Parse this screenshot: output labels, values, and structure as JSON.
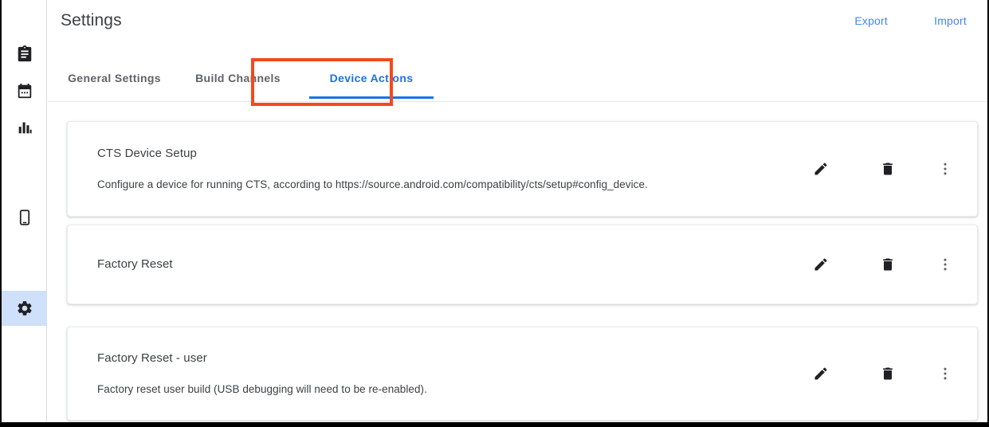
{
  "header": {
    "title": "Settings",
    "export_label": "Export",
    "import_label": "Import"
  },
  "sidebar": {
    "items": [
      {
        "name": "clipboard",
        "icon": "clipboard-icon",
        "active": false
      },
      {
        "name": "calendar",
        "icon": "calendar-icon",
        "active": false
      },
      {
        "name": "analytics",
        "icon": "bar-chart-icon",
        "active": false
      },
      {
        "name": "devices",
        "icon": "phone-icon",
        "active": false
      },
      {
        "name": "settings",
        "icon": "gear-icon",
        "active": true
      }
    ]
  },
  "tabs": [
    {
      "label": "General Settings",
      "active": false
    },
    {
      "label": "Build Channels",
      "active": false
    },
    {
      "label": "Device Actions",
      "active": true
    }
  ],
  "device_actions": [
    {
      "title": "CTS Device Setup",
      "description": "Configure a device for running CTS, according to https://source.android.com/compatibility/cts/setup#config_device."
    },
    {
      "title": "Factory Reset",
      "description": ""
    },
    {
      "title": "Factory Reset - user",
      "description": "Factory reset user build (USB debugging will need to be re-enabled)."
    }
  ],
  "row_actions": {
    "edit_label": "Edit",
    "delete_label": "Delete",
    "more_label": "More options"
  },
  "colors": {
    "accent_blue": "#1a73e8",
    "link_blue": "#4285f4",
    "highlight_red": "#f4491c",
    "rail_selected": "#cfe0fa"
  }
}
